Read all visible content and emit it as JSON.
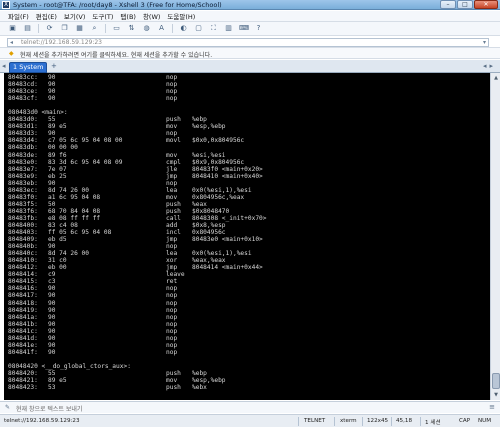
{
  "window": {
    "title": "System - root@TFA: /root/day8 - Xshell 3 (Free for Home/School)",
    "controls": [
      "–",
      "□",
      "✕"
    ]
  },
  "menu": [
    "파일(F)",
    "편집(E)",
    "보기(V)",
    "도구(T)",
    "탭(B)",
    "창(W)",
    "도움말(H)"
  ],
  "toolbar": {
    "icons": [
      "new-session-icon",
      "open-folder-icon",
      "reconnect-icon",
      "copy-icon",
      "paste-icon",
      "find-icon",
      "print-icon",
      "transfer-icon",
      "globe-icon",
      "font-icon",
      "color-icon",
      "lock-icon",
      "fullscreen-icon",
      "layout-icon",
      "keyboard-icon",
      "help-icon"
    ]
  },
  "address": {
    "value": "telnet://192.168.59.129:23"
  },
  "hint": {
    "text": "현재 세션을 추가하려면 여기를 클릭하세요. 현재 세션을 추가할 수 있습니다."
  },
  "tabs": {
    "active": "1 System"
  },
  "terminal": {
    "lines": [
      [
        "80483cc:",
        "90",
        "nop",
        ""
      ],
      [
        "80483cd:",
        "90",
        "nop",
        ""
      ],
      [
        "80483ce:",
        "90",
        "nop",
        ""
      ],
      [
        "80483cf:",
        "90",
        "nop",
        ""
      ],
      [
        "",
        "",
        "",
        ""
      ],
      [
        "080483d0 <main>:",
        "",
        "",
        ""
      ],
      [
        "80483d0:",
        "55",
        "push",
        "%ebp"
      ],
      [
        "80483d1:",
        "89 e5",
        "mov",
        "%esp,%ebp"
      ],
      [
        "80483d3:",
        "90",
        "nop",
        ""
      ],
      [
        "80483d4:",
        "c7 05 6c 95 04 08 00",
        "movl",
        "$0x0,0x804956c"
      ],
      [
        "80483db:",
        "00 00 00",
        "",
        ""
      ],
      [
        "80483de:",
        "89 f6",
        "mov",
        "%esi,%esi"
      ],
      [
        "80483e0:",
        "83 3d 6c 95 04 08 09",
        "cmpl",
        "$0x9,0x804956c"
      ],
      [
        "80483e7:",
        "7e 07",
        "jle",
        "80483f0 <main+0x20>"
      ],
      [
        "80483e9:",
        "eb 25",
        "jmp",
        "8048410 <main+0x40>"
      ],
      [
        "80483eb:",
        "90",
        "nop",
        ""
      ],
      [
        "80483ec:",
        "8d 74 26 00",
        "lea",
        "0x0(%esi,1),%esi"
      ],
      [
        "80483f0:",
        "a1 6c 95 04 08",
        "mov",
        "0x804956c,%eax"
      ],
      [
        "80483f5:",
        "50",
        "push",
        "%eax"
      ],
      [
        "80483f6:",
        "68 70 84 04 08",
        "push",
        "$0x8048470"
      ],
      [
        "80483fb:",
        "e8 08 ff ff ff",
        "call",
        "8048308 <_init+0x70>"
      ],
      [
        "8048400:",
        "83 c4 08",
        "add",
        "$0x8,%esp"
      ],
      [
        "8048403:",
        "ff 05 6c 95 04 08",
        "incl",
        "0x804956c"
      ],
      [
        "8048409:",
        "eb d5",
        "jmp",
        "80483e0 <main+0x10>"
      ],
      [
        "804840b:",
        "90",
        "nop",
        ""
      ],
      [
        "804840c:",
        "8d 74 26 00",
        "lea",
        "0x0(%esi,1),%esi"
      ],
      [
        "8048410:",
        "31 c0",
        "xor",
        "%eax,%eax"
      ],
      [
        "8048412:",
        "eb 00",
        "jmp",
        "8048414 <main+0x44>"
      ],
      [
        "8048414:",
        "c9",
        "leave",
        ""
      ],
      [
        "8048415:",
        "c3",
        "ret",
        ""
      ],
      [
        "8048416:",
        "90",
        "nop",
        ""
      ],
      [
        "8048417:",
        "90",
        "nop",
        ""
      ],
      [
        "8048418:",
        "90",
        "nop",
        ""
      ],
      [
        "8048419:",
        "90",
        "nop",
        ""
      ],
      [
        "804841a:",
        "90",
        "nop",
        ""
      ],
      [
        "804841b:",
        "90",
        "nop",
        ""
      ],
      [
        "804841c:",
        "90",
        "nop",
        ""
      ],
      [
        "804841d:",
        "90",
        "nop",
        ""
      ],
      [
        "804841e:",
        "90",
        "nop",
        ""
      ],
      [
        "804841f:",
        "90",
        "nop",
        ""
      ],
      [
        "",
        "",
        "",
        ""
      ],
      [
        "08048420 <__do_global_ctors_aux>:",
        "",
        "",
        ""
      ],
      [
        "8048420:",
        "55",
        "push",
        "%ebp"
      ],
      [
        "8048421:",
        "89 e5",
        "mov",
        "%esp,%ebp"
      ],
      [
        "8048423:",
        "53",
        "push",
        "%ebx"
      ]
    ]
  },
  "compose": {
    "placeholder": "현재 창으로 텍스트 보내기"
  },
  "status": {
    "connection": "telnet://192.168.59.129:23",
    "protocol": "TELNET",
    "terminal": "xterm",
    "size": "122x45",
    "cursor": "45,18",
    "sessions": "1 세션",
    "caps": "CAP",
    "num": "NUM"
  }
}
